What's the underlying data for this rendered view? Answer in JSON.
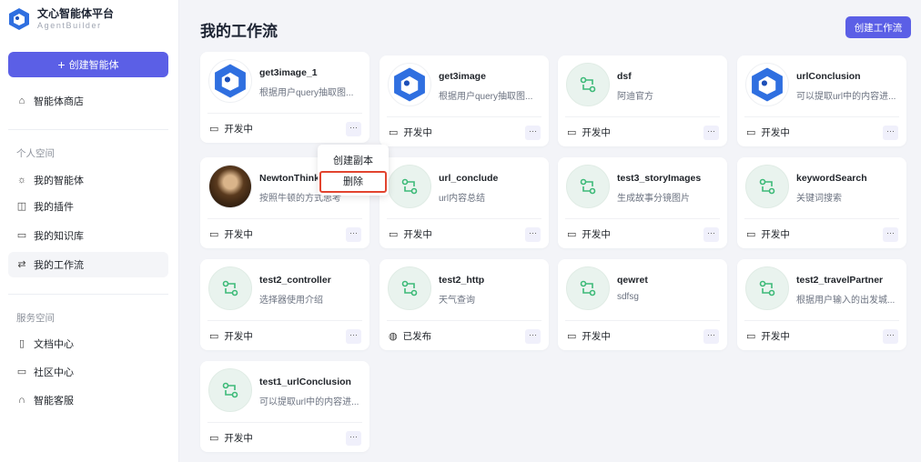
{
  "sidebar": {
    "brand": "文心智能体平台",
    "brand_sub": "AgentBuilder",
    "create_label": "创建智能体",
    "store": "智能体商店",
    "personal_title": "个人空间",
    "personal": [
      "我的智能体",
      "我的插件",
      "我的知识库",
      "我的工作流"
    ],
    "service_title": "服务空间",
    "service": [
      "文档中心",
      "社区中心",
      "智能客服"
    ]
  },
  "main": {
    "title": "我的工作流",
    "create_label": "创建工作流"
  },
  "cards": [
    {
      "name": "get3image_1",
      "desc": "根据用户query抽取图...",
      "status": "开发中",
      "icon": "logo"
    },
    {
      "name": "get3image",
      "desc": "根据用户query抽取图...",
      "status": "开发中",
      "icon": "logo"
    },
    {
      "name": "dsf",
      "desc": "阿迪官方",
      "status": "开发中",
      "icon": "workflow"
    },
    {
      "name": "urlConclusion",
      "desc": "可以提取url中的内容进...",
      "status": "开发中",
      "icon": "logo"
    },
    {
      "name": "NewtonThink",
      "desc": "按照牛顿的方式思考",
      "status": "开发中",
      "icon": "portrait"
    },
    {
      "name": "url_conclude",
      "desc": "url内容总结",
      "status": "开发中",
      "icon": "workflow"
    },
    {
      "name": "test3_storyImages",
      "desc": "生成故事分镜图片",
      "status": "开发中",
      "icon": "workflow"
    },
    {
      "name": "keywordSearch",
      "desc": "关键词搜索",
      "status": "开发中",
      "icon": "workflow"
    },
    {
      "name": "test2_controller",
      "desc": "选择器使用介绍",
      "status": "开发中",
      "icon": "workflow"
    },
    {
      "name": "test2_http",
      "desc": "天气查询",
      "status": "已发布",
      "icon": "workflow"
    },
    {
      "name": "qewret",
      "desc": "sdfsg",
      "status": "开发中",
      "icon": "workflow"
    },
    {
      "name": "test2_travelPartner",
      "desc": "根据用户输入的出发城...",
      "status": "开发中",
      "icon": "workflow"
    },
    {
      "name": "test1_urlConclusion",
      "desc": "可以提取url中的内容进...",
      "status": "开发中",
      "icon": "workflow"
    }
  ],
  "context_menu": {
    "copy": "创建副本",
    "delete": "删除"
  },
  "colors": {
    "accent": "#5b5fe6",
    "highlight": "#e2442f",
    "workflow_icon": "#3dba78"
  }
}
